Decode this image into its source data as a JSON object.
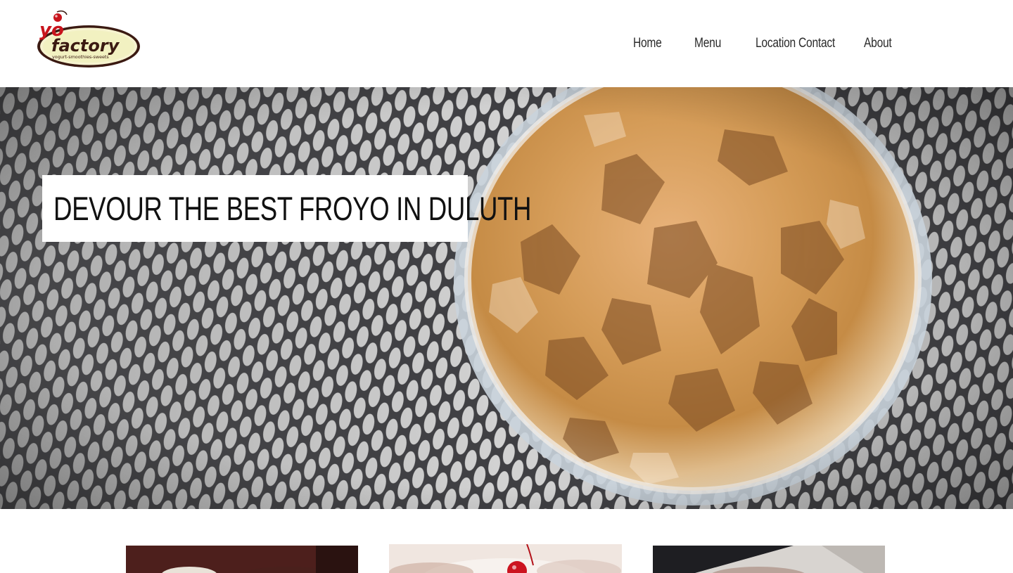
{
  "brand": {
    "logo_main_yo": "yo",
    "logo_main_factory": "factory",
    "logo_tagline": "yogurt-smoothies-sweets",
    "colors": {
      "red": "#b5121b",
      "brown": "#3b1a12",
      "cream": "#f3f0c4"
    }
  },
  "nav": {
    "items": [
      {
        "label": "Home"
      },
      {
        "label": "Menu"
      },
      {
        "label": "Location Contact"
      },
      {
        "label": "About"
      }
    ]
  },
  "hero": {
    "title": "DEVOUR THE BEST FROYO IN DULUTH",
    "image_alt": "iced-coffee-cup-photo"
  },
  "cards": [
    {
      "image": "dessert-photo-1"
    },
    {
      "image": "cherry-sundae-photo"
    },
    {
      "image": "dessert-photo-3"
    }
  ]
}
